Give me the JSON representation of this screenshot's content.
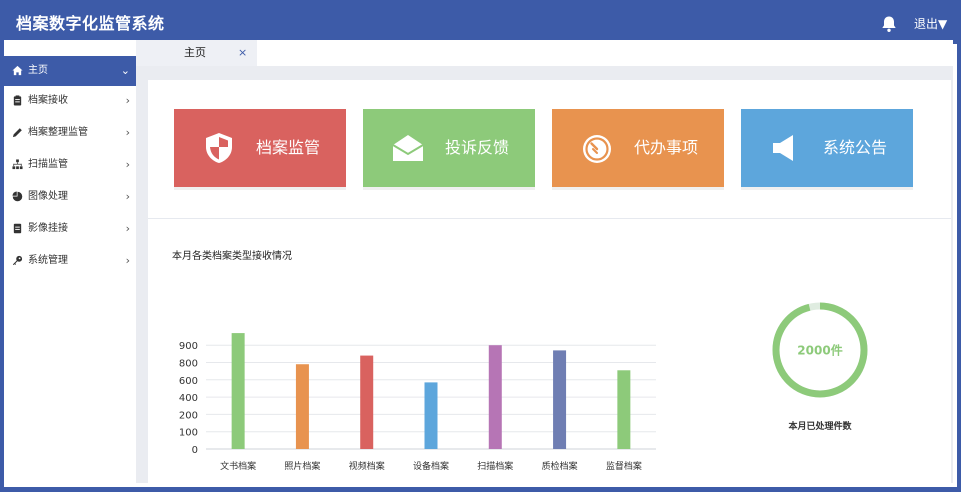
{
  "app": {
    "title": "档案数字化监管系统",
    "logout_label": "退出▼"
  },
  "sidebar": {
    "items": [
      {
        "label": "主页",
        "icon": "home-icon",
        "active": true
      },
      {
        "label": "档案接收",
        "icon": "clipboard-icon"
      },
      {
        "label": "档案整理监管",
        "icon": "edit-icon"
      },
      {
        "label": "扫描监管",
        "icon": "sitemap-icon"
      },
      {
        "label": "图像处理",
        "icon": "pie-icon"
      },
      {
        "label": "影像挂接",
        "icon": "document-icon"
      },
      {
        "label": "系统管理",
        "icon": "key-icon"
      }
    ]
  },
  "tabs": [
    {
      "label": "主页",
      "close": "×"
    }
  ],
  "cards": [
    {
      "label": "档案监管",
      "icon": "shield-icon",
      "color": "#d9625f"
    },
    {
      "label": "投诉反馈",
      "icon": "envelope-open-icon",
      "color": "#8dca7a"
    },
    {
      "label": "代办事项",
      "icon": "timer-icon",
      "color": "#e8934f"
    },
    {
      "label": "系统公告",
      "icon": "megaphone-icon",
      "color": "#5da6dc"
    }
  ],
  "chart_data": {
    "type": "bar",
    "title": "本月各类档案类型接收情况",
    "categories": [
      "文书档案",
      "照片档案",
      "视频档案",
      "设备档案",
      "扫描档案",
      "质检档案",
      "监督档案"
    ],
    "values": [
      970,
      780,
      840,
      570,
      900,
      870,
      710
    ],
    "colors": [
      "#8dca7a",
      "#e8934f",
      "#d9625f",
      "#5da6dc",
      "#b675b5",
      "#6f7eb3",
      "#8dca7a"
    ],
    "yticks": [
      0,
      100,
      200,
      400,
      600,
      800,
      900
    ],
    "ylim": [
      0,
      1000
    ],
    "grid": true
  },
  "gauge": {
    "value_label": "2000件",
    "caption": "本月已处理件数",
    "fraction": 0.96,
    "color": "#8dca7a",
    "track_color": "#dfece0"
  }
}
